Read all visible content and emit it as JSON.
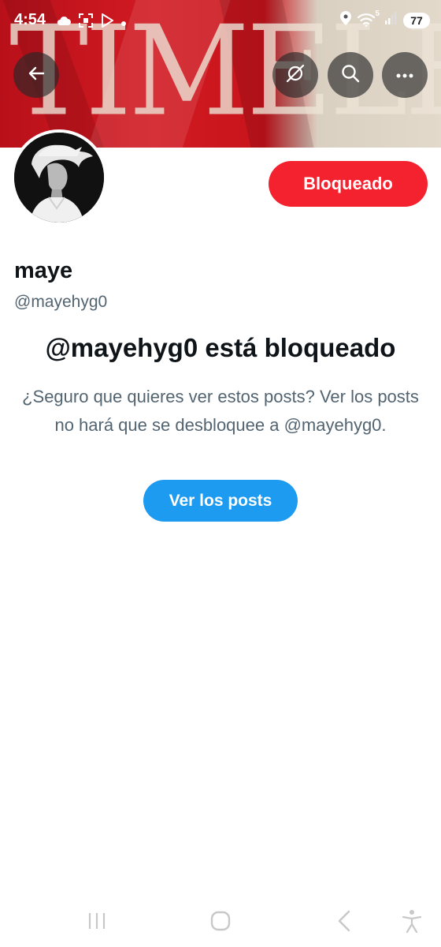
{
  "status_bar": {
    "time": "4:54",
    "left_icons": [
      "cloud-icon",
      "screenshot-icon",
      "play-store-icon",
      "dot-icon"
    ],
    "right_icons": [
      "location-icon",
      "wifi-icon",
      "signal-icon"
    ],
    "wifi_badge": "5",
    "battery": "77"
  },
  "banner": {
    "text": "TIMELESS",
    "colors": {
      "red": "#c8141c",
      "cream": "#e2d9cb"
    }
  },
  "top_actions": {
    "back_icon": "arrow-left-icon",
    "grok_icon": "slash-circle-icon",
    "search_icon": "search-icon",
    "more_icon": "more-horizontal-icon"
  },
  "profile": {
    "name": "maye",
    "handle": "@mayehyg0",
    "blocked_button_label": "Bloqueado"
  },
  "blocked_notice": {
    "title": "@mayehyg0 está bloqueado",
    "description": "¿Seguro que quieres ver estos posts? Ver los posts no hará que se desbloquee a @mayehyg0.",
    "view_button_label": "Ver los posts"
  },
  "nav_bar": {
    "icons": [
      "recent-apps-icon",
      "home-icon",
      "back-icon",
      "accessibility-icon"
    ]
  },
  "colors": {
    "blocked_red": "#f4212e",
    "twitter_blue": "#1d9bf0",
    "text_primary": "#0f1419",
    "text_secondary": "#536471"
  }
}
